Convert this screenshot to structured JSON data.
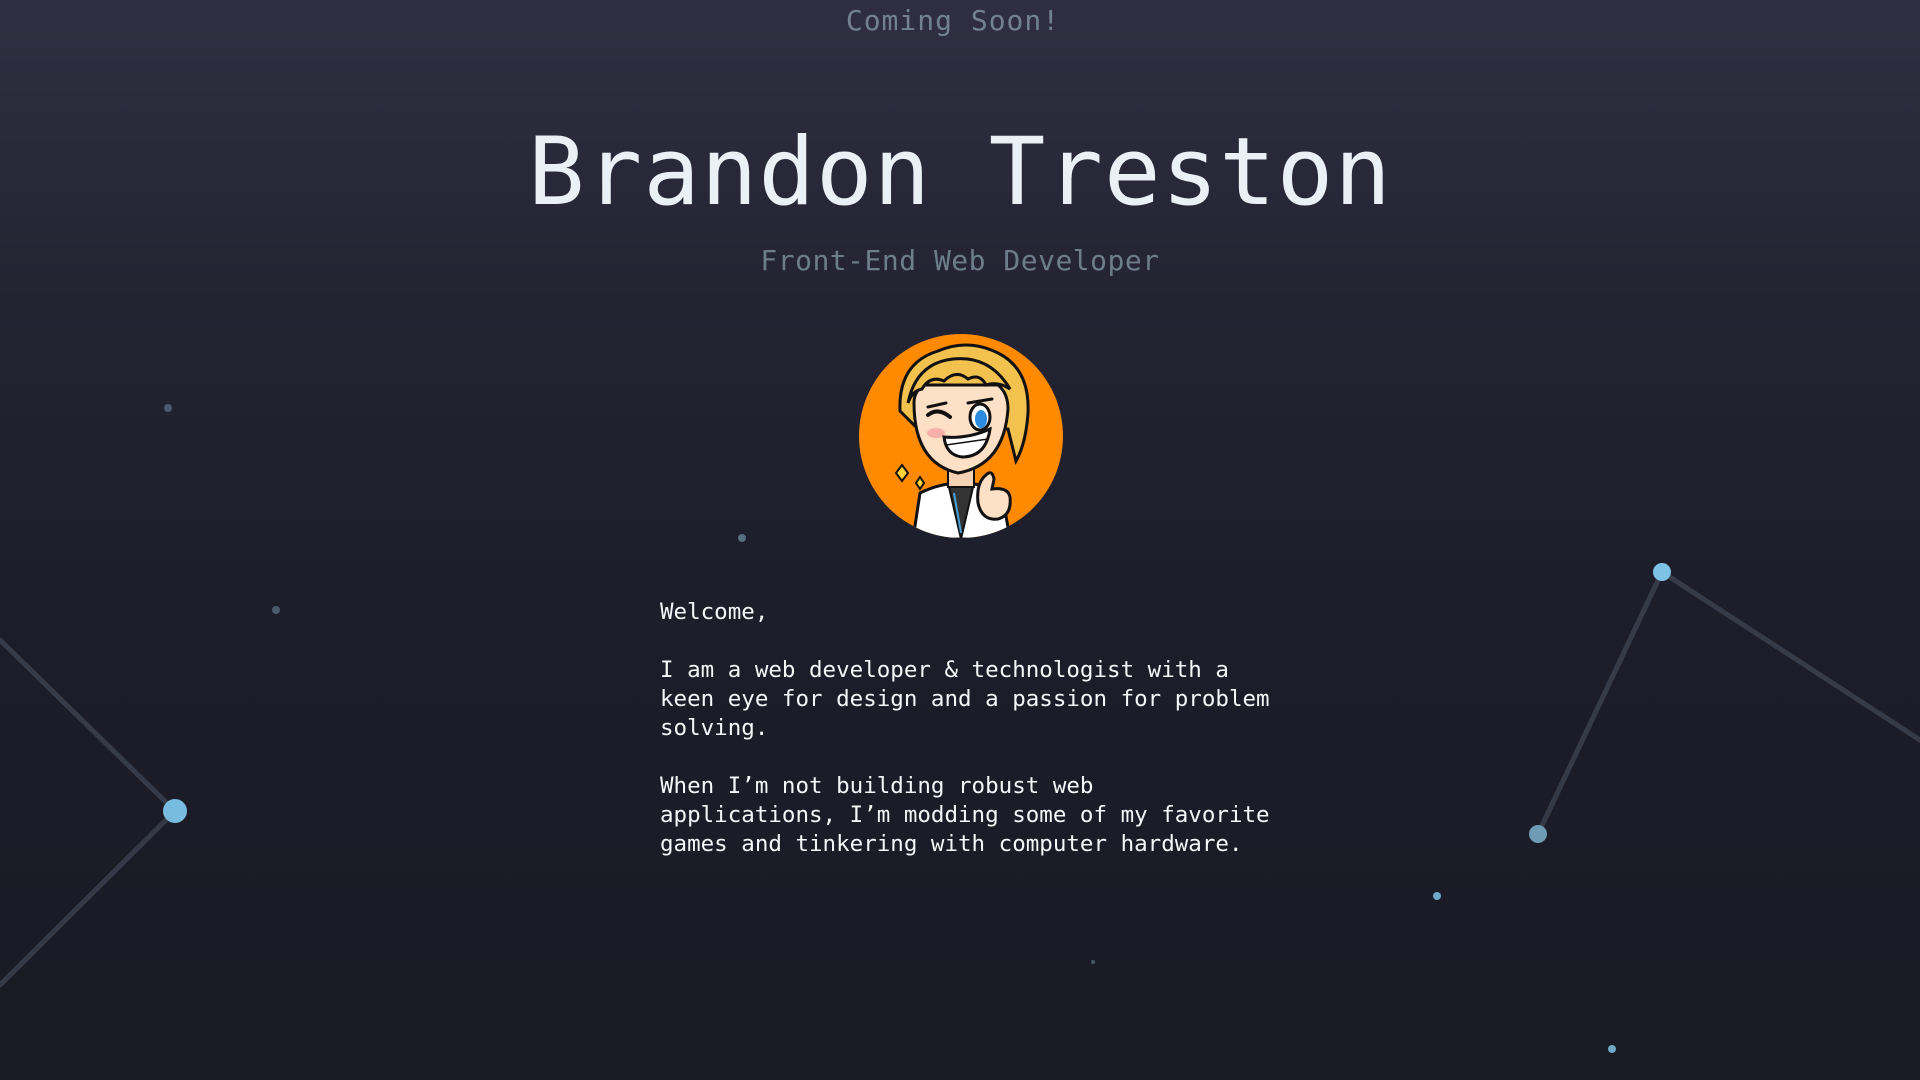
{
  "page": {
    "coming_soon": "Coming Soon!",
    "name": "Brandon Treston",
    "role": "Front-End Web Developer"
  },
  "intro": {
    "greeting": "Welcome,",
    "paragraph_1": "I am a web developer & technologist with a\nkeen eye for design and a passion for problem\nsolving.",
    "paragraph_2": "When I’m not building robust web\napplications, I’m modding some of my favorite\ngames and tinkering with computer hardware."
  },
  "colors": {
    "background_top": "#2f2f41",
    "background_bottom": "#191a24",
    "avatar_orange": "#ff8a00",
    "node_blue": "#7ec3e6",
    "heading": "#eaf0f6",
    "muted": "#73818e"
  },
  "icons": {
    "avatar": "cartoon-developer-avatar",
    "background": "particle-network"
  }
}
